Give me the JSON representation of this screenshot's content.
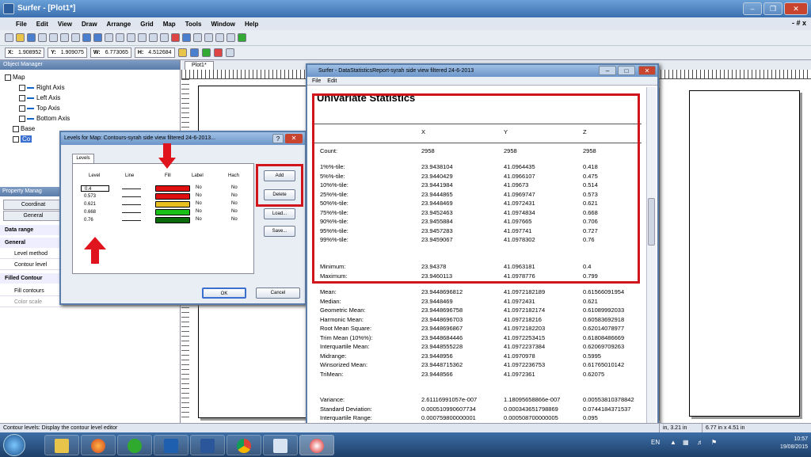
{
  "app": {
    "title": "Surfer - [Plot1*]",
    "window_buttons": [
      "–",
      "❐",
      "✕"
    ],
    "mdi_controls": "- # x"
  },
  "menu": [
    "File",
    "Edit",
    "View",
    "Draw",
    "Arrange",
    "Grid",
    "Map",
    "Tools",
    "Window",
    "Help"
  ],
  "coords": {
    "x_label": "X:",
    "x_value": "1.908952",
    "y_label": "Y:",
    "y_value": "1.909075",
    "w_label": "W:",
    "w_value": "6.773065",
    "h_label": "H:",
    "h_value": "4.512684"
  },
  "object_manager": {
    "title": "Object Manager",
    "items": [
      "Map",
      "Right Axis",
      "Left Axis",
      "Top Axis",
      "Bottom Axis",
      "Base",
      "Co"
    ]
  },
  "property_manager": {
    "title": "Property Manag",
    "tabs": [
      "Coordinat",
      "General"
    ],
    "rows": [
      {
        "type": "section",
        "label": "Data range"
      },
      {
        "type": "section",
        "label": "General"
      },
      {
        "type": "row",
        "label": "Level method"
      },
      {
        "type": "row",
        "label": "Contour level"
      },
      {
        "type": "section",
        "label": "Filled Contour"
      },
      {
        "type": "row",
        "label": "Fill contours"
      },
      {
        "type": "row",
        "label": "Color scale"
      }
    ]
  },
  "plot_tab": "Plot1*",
  "levels_dialog": {
    "title": "Levels for Map: Contours-syrah side view filtered 24-6-2013...",
    "help_btn": "?",
    "close_btn": "✕",
    "tab": "Levels",
    "headers": [
      "Level",
      "Line",
      "Fill",
      "Label",
      "Hach"
    ],
    "rows": [
      {
        "level": "0.4",
        "fill": "#e01010",
        "label": "No",
        "hach": "No"
      },
      {
        "level": "0.573",
        "fill": "#e01010",
        "label": "No",
        "hach": "No"
      },
      {
        "level": "0.621",
        "fill": "#e8c020",
        "label": "No",
        "hach": "No"
      },
      {
        "level": "0.668",
        "fill": "#18c018",
        "label": "No",
        "hach": "No"
      },
      {
        "level": "0.76",
        "fill": "#0a6a0a",
        "label": "No",
        "hach": "No"
      }
    ],
    "buttons": [
      "Add",
      "Delete",
      "Load...",
      "Save..."
    ],
    "ok": "OK",
    "cancel": "Cancel"
  },
  "stats_window": {
    "title": "Surfer - DataStatisticsReport-syrah side view filtered 24-6-2013",
    "menu": [
      "File",
      "Edit"
    ],
    "heading": "Univariate Statistics",
    "columns": [
      "X",
      "Y",
      "Z"
    ],
    "count": {
      "label": "Count:",
      "values": [
        "2958",
        "2958",
        "2958"
      ]
    },
    "percentiles": [
      {
        "label": "1%%-tile:",
        "values": [
          "23.9438104",
          "41.0964435",
          "0.418"
        ]
      },
      {
        "label": "5%%-tile:",
        "values": [
          "23.9440429",
          "41.0966107",
          "0.475"
        ]
      },
      {
        "label": "10%%-tile:",
        "values": [
          "23.9441984",
          "41.09673",
          "0.514"
        ]
      },
      {
        "label": "25%%-tile:",
        "values": [
          "23.9444865",
          "41.0969747",
          "0.573"
        ]
      },
      {
        "label": "50%%-tile:",
        "values": [
          "23.9448469",
          "41.0972431",
          "0.621"
        ]
      },
      {
        "label": "75%%-tile:",
        "values": [
          "23.9452463",
          "41.0974834",
          "0.668"
        ]
      },
      {
        "label": "90%%-tile:",
        "values": [
          "23.9455884",
          "41.097665",
          "0.706"
        ]
      },
      {
        "label": "95%%-tile:",
        "values": [
          "23.9457283",
          "41.097741",
          "0.727"
        ]
      },
      {
        "label": "99%%-tile:",
        "values": [
          "23.9459067",
          "41.0978302",
          "0.76"
        ]
      }
    ],
    "minmax": [
      {
        "label": "Minimum:",
        "values": [
          "23.94378",
          "41.0963181",
          "0.4"
        ]
      },
      {
        "label": "Maximum:",
        "values": [
          "23.9460113",
          "41.0978776",
          "0.799"
        ]
      }
    ],
    "means": [
      {
        "label": "Mean:",
        "values": [
          "23.9448696812",
          "41.0972182189",
          "0.61566091954"
        ]
      },
      {
        "label": "Median:",
        "values": [
          "23.9448469",
          "41.0972431",
          "0.621"
        ]
      },
      {
        "label": "Geometric Mean:",
        "values": [
          "23.9448696758",
          "41.0972182174",
          "0.61089992033"
        ]
      },
      {
        "label": "Harmonic Mean:",
        "values": [
          "23.9448696703",
          "41.097218216",
          "0.60583692918"
        ]
      },
      {
        "label": "Root Mean Square:",
        "values": [
          "23.9448696867",
          "41.0972182203",
          "0.62014078977"
        ]
      },
      {
        "label": "Trim Mean (10%%):",
        "values": [
          "23.9448684446",
          "41.0972253415",
          "0.61808486669"
        ]
      },
      {
        "label": "Interquartile Mean:",
        "values": [
          "23.9448555228",
          "41.0972237384",
          "0.62069709263"
        ]
      },
      {
        "label": "Midrange:",
        "values": [
          "23.9448956",
          "41.0970978",
          "0.5995"
        ]
      },
      {
        "label": "Winsorized Mean:",
        "values": [
          "23.9448715362",
          "41.0972236753",
          "0.61765010142"
        ]
      },
      {
        "label": "TriMean:",
        "values": [
          "23.9448566",
          "41.0972361",
          "0.62075"
        ]
      }
    ],
    "variance": [
      {
        "label": "Variance:",
        "values": [
          "2.61116991057e-007",
          "1.18095658866e-007",
          "0.00553810378842"
        ]
      },
      {
        "label": "Standard Deviation:",
        "values": [
          "0.000510990607734",
          "0.000343651798869",
          "0.0744184371537"
        ]
      },
      {
        "label": "Interquartile Range:",
        "values": [
          "0.000759800000001",
          "0.000508700000005",
          "0.095"
        ]
      }
    ]
  },
  "status": {
    "text": "Contour levels: Display the contour level editor",
    "pos": "in, 3.21 in",
    "size": "6.77 in x 4.51 in"
  },
  "taskbar": {
    "lang": "EN",
    "time": "10:57",
    "date": "19/08/2015"
  },
  "colors": {
    "highlight_red": "#d0151c",
    "title_blue": "#5b7daa"
  }
}
